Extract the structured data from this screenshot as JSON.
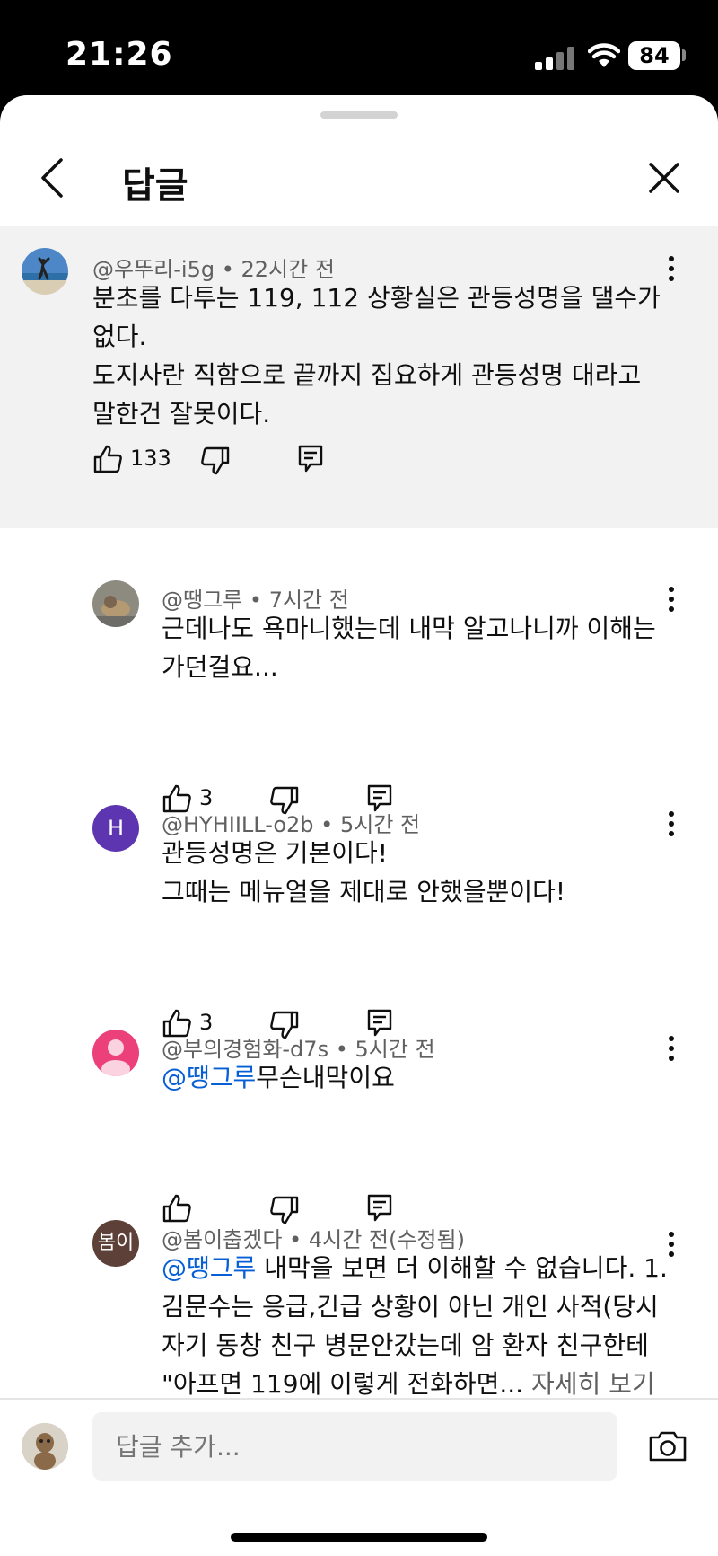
{
  "status_bar": {
    "time": "21:26",
    "battery": "84"
  },
  "header": {
    "title": "답글"
  },
  "parent_comment": {
    "author": "@우뚜리-i5g",
    "time": "22시간 전",
    "lines": [
      "분초를 다투는 119, 112 상황실은 관등성명을 댈수가",
      "없다.",
      "도지사란 직함으로 끝까지 집요하게 관등성명 대라고",
      "말한건 잘못이다."
    ],
    "likes": "133"
  },
  "replies": [
    {
      "author": "@땡그루",
      "time": "7시간 전",
      "lines": [
        "근데나도 욕마니했는데  내막 알고나니까 이해는",
        "가던걸요..."
      ],
      "likes": "3"
    },
    {
      "author": "@HYHIILL-o2b",
      "time": "5시간 전",
      "avatar_letter": "H",
      "lines": [
        "관등성명은 기본이다!",
        "그때는 메뉴얼을 제대로 안했을뿐이다!"
      ],
      "likes": "3"
    },
    {
      "author": "@부의경험화-d7s",
      "time": "5시간 전",
      "mention": "@땡그루",
      "text": "무슨내막이요",
      "likes": ""
    },
    {
      "author": "@봄이춥겠다",
      "time": "4시간 전(수정됨)",
      "avatar_text": "봄이",
      "mention": "@땡그루",
      "first_line": "  내막을 보면 더 이해할 수 없습니다. 1.",
      "lines": [
        "김문수는 응급,긴급 상황이 아닌 개인 사적(당시",
        "자기 동창 친구 병문안갔는데 암 환자 친구한테"
      ],
      "last_line": "\"아프면 119에 이렇게 전화하면... ",
      "more": "자세히 보기"
    }
  ],
  "separator": "•",
  "composer": {
    "placeholder": "답글 추가..."
  },
  "colors": {
    "mention": "#065fd4",
    "parent_bg": "#f2f2f2",
    "h_avatar": "#5e35b1",
    "pink_avatar": "#ec407a",
    "brown_avatar": "#5d4037"
  }
}
